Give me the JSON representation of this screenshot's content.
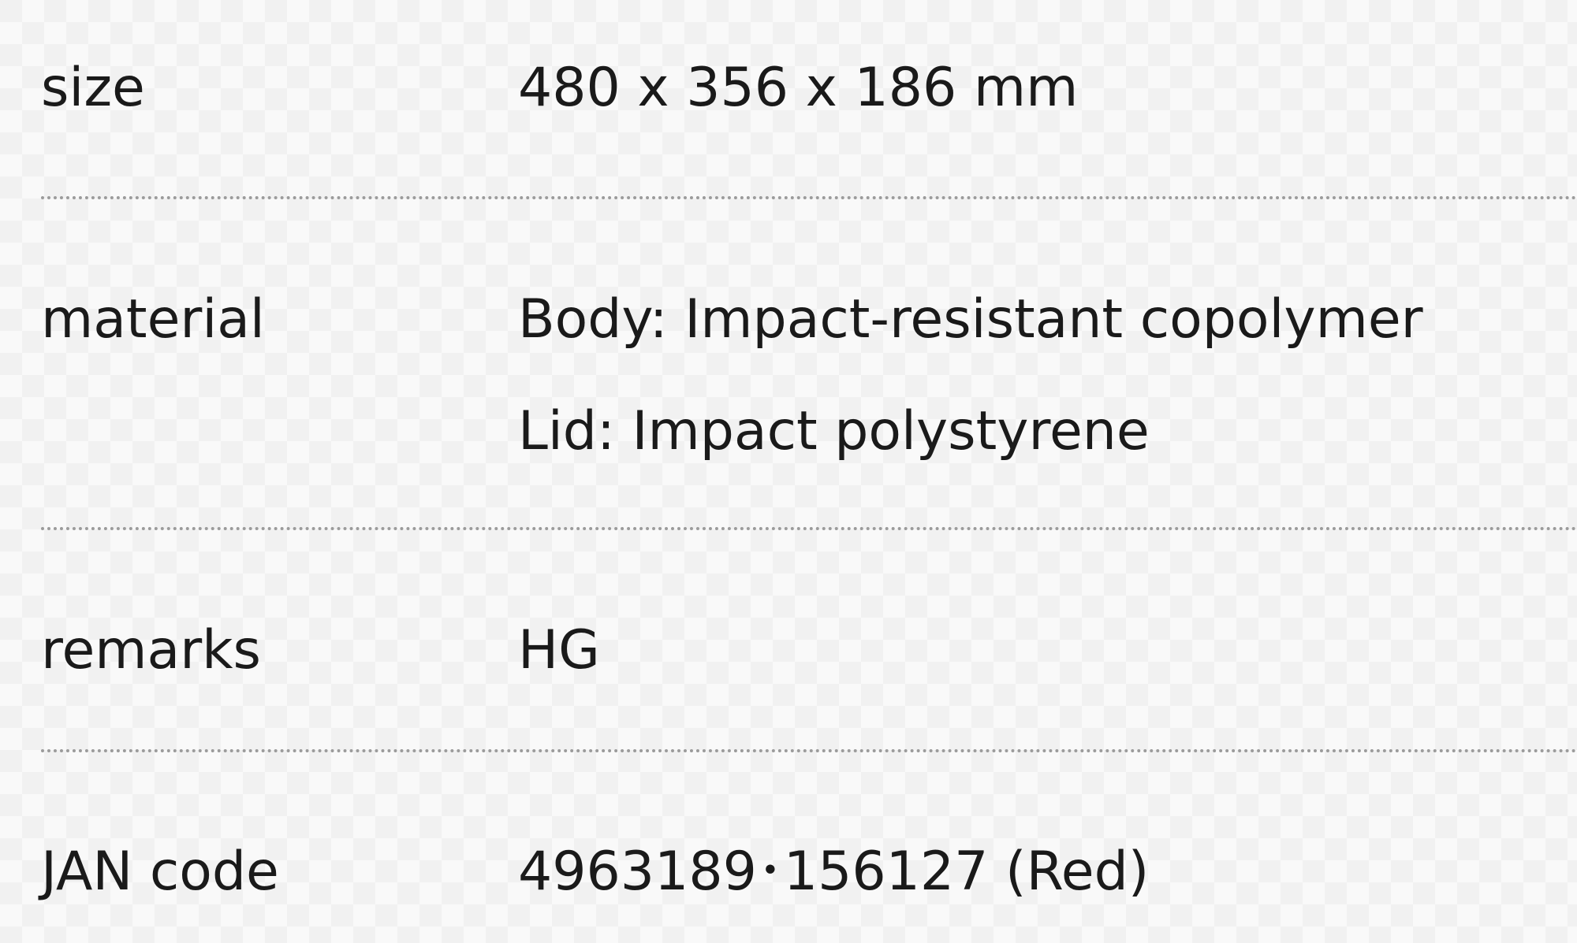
{
  "spec": {
    "rows": [
      {
        "label": "size",
        "values": [
          "480 x 356 x 186 mm"
        ]
      },
      {
        "label": "material",
        "values": [
          "Body: Impact-resistant copolymer",
          "Lid: Impact polystyrene"
        ]
      },
      {
        "label": "remarks",
        "values": [
          "HG"
        ]
      },
      {
        "label": "JAN code",
        "values": [
          "4963189･156127 (Red)"
        ]
      }
    ]
  }
}
